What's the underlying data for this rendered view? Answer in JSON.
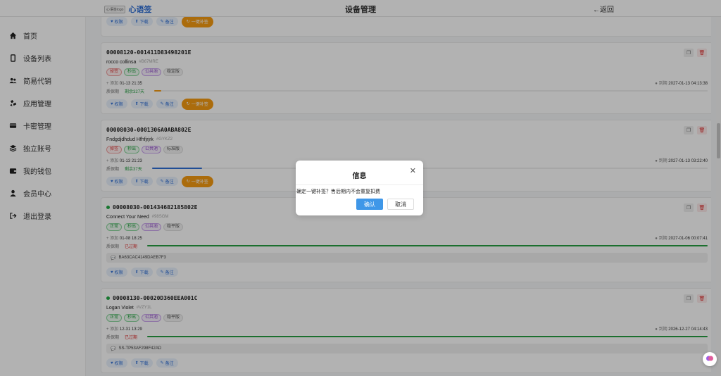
{
  "header": {
    "logo_mark": "心语签logo",
    "logo_text": "心语签",
    "title": "设备管理",
    "back_label": "返回"
  },
  "sidebar": {
    "items": [
      {
        "label": "首页",
        "icon": "home-icon"
      },
      {
        "label": "设备列表",
        "icon": "phone-icon"
      },
      {
        "label": "简易代销",
        "icon": "users-icon"
      },
      {
        "label": "应用管理",
        "icon": "app-icon"
      },
      {
        "label": "卡密管理",
        "icon": "card-icon"
      },
      {
        "label": "独立账号",
        "icon": "layers-icon"
      },
      {
        "label": "我的钱包",
        "icon": "wallet-icon"
      },
      {
        "label": "会员中心",
        "icon": "user-icon"
      },
      {
        "label": "退出登录",
        "icon": "logout-icon"
      }
    ]
  },
  "buttons": {
    "permission": "权限",
    "download": "下载",
    "note": "备注",
    "resign": "一键补签"
  },
  "labels": {
    "add_prefix": "添加",
    "expire_prefix": "到期",
    "warranty": "质保期"
  },
  "cards": [
    {
      "id": "00008120-001411D83498201E",
      "name": "rocco collinsa",
      "code": "#B67MRE",
      "tags": [
        "掉签",
        "秒出",
        "公共池",
        "稳定版"
      ],
      "added": "01-13 21:35",
      "expires": "2027-01-13 04:13:38",
      "warranty_text": "剩余327天",
      "warranty_fraction": 0.013
    },
    {
      "id": "00008030-0001306A0ABA802E",
      "name": "Fndgdjdhdud Hfhfjrjrk",
      "code": "#GYKZ2",
      "tags": [
        "掉签",
        "秒出",
        "公共池",
        "标准版"
      ],
      "added": "01-13 21:23",
      "expires": "2027-01-13 03:22:40",
      "warranty_text": "剩余37天",
      "warranty_fraction": 0.09
    },
    {
      "id": "00008030-001434682185802E",
      "name": "Connect Your Need",
      "code": "#98SGM",
      "tags": [
        "正常",
        "秒出",
        "公共池",
        "稳平版"
      ],
      "added": "01-08 18:25",
      "expires": "2027-01-06 00:07:41",
      "warranty_text": "已过期",
      "warranty_fraction": 1.0,
      "serial": "BA63CAC4149DAEB7F3"
    },
    {
      "id": "00008130-00020D360EEA001C",
      "name": "Logan Violet",
      "code": "#VZY1L",
      "tags": [
        "正常",
        "秒出",
        "公共池",
        "稳平版"
      ],
      "added": "12-31 13:29",
      "expires": "2026-12-27 04:14:43",
      "warranty_text": "已过期",
      "warranty_fraction": 1.0,
      "serial": "SS-TP53AF298F42AD"
    }
  ],
  "dialog": {
    "title": "信息",
    "message": "确定一键补签？售后期内不会重复扣费",
    "confirm": "确认",
    "cancel": "取消"
  },
  "colors": {
    "accent": "#2f6fd6",
    "orange": "#f59b12",
    "green": "#27a043",
    "red": "#e03333"
  }
}
